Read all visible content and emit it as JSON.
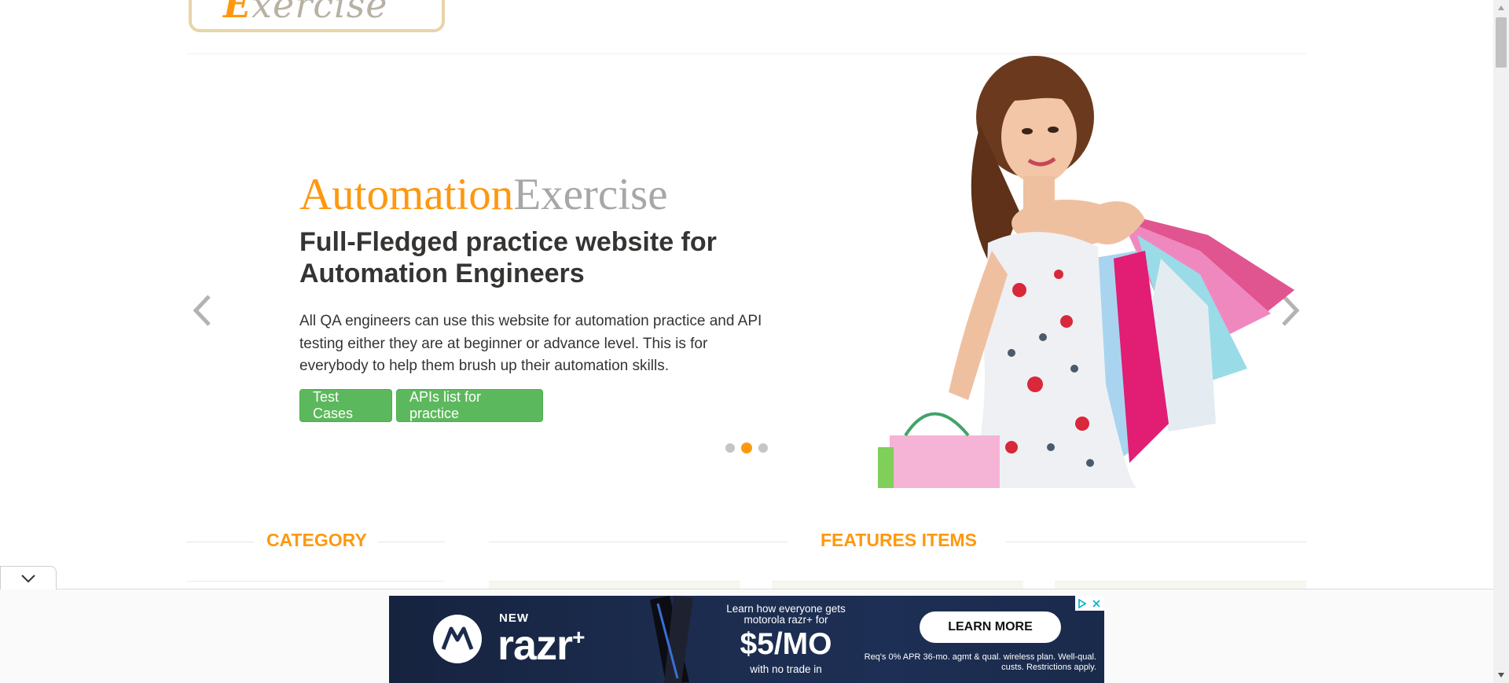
{
  "header": {
    "logo_first": "E",
    "logo_rest": "xercise"
  },
  "slider": {
    "brand_part1": "Automation",
    "brand_part2": "Exercise",
    "headline": "Full-Fledged practice website for Automation Engineers",
    "description": "All QA engineers can use this website for automation practice and API testing either they are at beginner or advance level. This is for everybody to help them brush up their automation skills.",
    "button_test_cases": "Test Cases",
    "button_apis": "APIs list for practice",
    "active_slide": 2,
    "slide_count": 3
  },
  "sections": {
    "category": "CATEGORY",
    "features": "FEATURES ITEMS"
  },
  "ad": {
    "new": "NEW",
    "product": "razr",
    "product_plus": "+",
    "learn_line": "Learn how everyone gets motorola razr+ for",
    "price": "$5/MO",
    "no_trade": "with no trade in",
    "cta": "LEARN MORE",
    "legal": "Req's 0% APR 36-mo. agmt & qual. wireless plan. Well-qual. custs. Restrictions apply."
  },
  "colors": {
    "brand_orange": "#fe980f",
    "brand_gray": "#a7a7a7",
    "button_green": "#5cb85c",
    "ad_navy": "#1c2c4e"
  }
}
